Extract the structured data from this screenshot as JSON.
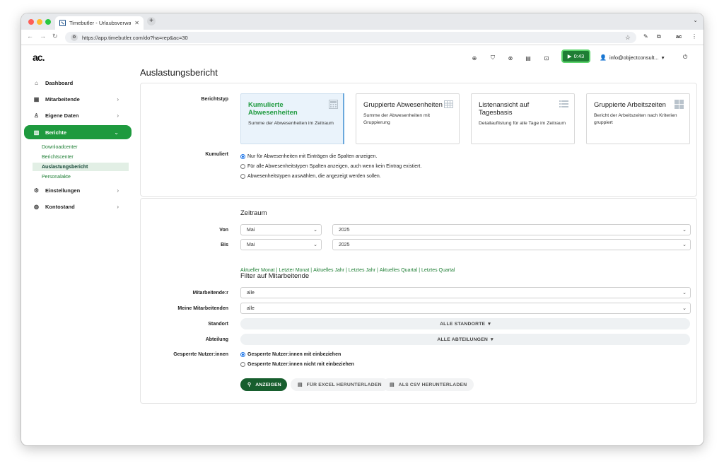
{
  "browser": {
    "tab_title": "Timebutler - Urlaubsverwaltu",
    "url": "https://app.timebutler.com/do?ha=rep&ac=30"
  },
  "header": {
    "logo": "ac.",
    "timer": "0:43",
    "user": "info@objectconsult...",
    "icons": [
      "support-icon",
      "pin-icon",
      "globe-icon",
      "calendar-icon",
      "inbox-icon"
    ]
  },
  "sidebar": {
    "items": [
      {
        "label": "Dashboard",
        "icon": "home-icon"
      },
      {
        "label": "Mitarbeitende",
        "icon": "building-icon"
      },
      {
        "label": "Eigene Daten",
        "icon": "person-icon"
      },
      {
        "label": "Berichte",
        "icon": "chart-icon"
      },
      {
        "label": "Einstellungen",
        "icon": "gear-icon"
      },
      {
        "label": "Kontostand",
        "icon": "wallet-icon"
      }
    ],
    "subitems": [
      "Downloadcenter",
      "Berichtscenter",
      "Auslastungsbericht",
      "Personalakte"
    ]
  },
  "page": {
    "title": "Auslastungsbericht"
  },
  "report": {
    "type_label": "Berichtstyp",
    "types": [
      {
        "title": "Kumulierte Abwesenheiten",
        "desc": "Summe der Abwesenheiten im Zeitraum"
      },
      {
        "title": "Gruppierte Abwesenheiten",
        "desc": "Summe der Abwesenheiten mit Gruppierung"
      },
      {
        "title": "Listenansicht auf Tagesbasis",
        "desc": "Detailauflistung für alle Tage im Zeitraum"
      },
      {
        "title": "Gruppierte Arbeitszeiten",
        "desc": "Bericht der Arbeitszeiten nach Kriterien gruppiert"
      }
    ],
    "kumuliert_label": "Kumuliert",
    "kumuliert_options": [
      "Nur für Abwesenheiten mit Einträgen die Spalten anzeigen.",
      "Für alle Abwesenheitstypen Spalten anzeigen, auch wenn kein Eintrag existiert.",
      "Abwesenheitstypen auswählen, die angezeigt werden sollen."
    ]
  },
  "zeitraum": {
    "title": "Zeitraum",
    "von_label": "Von",
    "bis_label": "Bis",
    "von_month": "Mai",
    "von_year": "2025",
    "bis_month": "Mai",
    "bis_year": "2025",
    "quicklinks": [
      "Aktueller Monat",
      "Letzter Monat",
      "Aktuelles Jahr",
      "Letztes Jahr",
      "Aktuelles Quartal",
      "Letztes Quartal"
    ]
  },
  "filter": {
    "title": "Filter auf Mitarbeitende",
    "mitarbeitende_label": "Mitarbeitende:r",
    "mitarbeitende_value": "alle",
    "meine_label": "Meine Mitarbeitenden",
    "meine_value": "alle",
    "standort_label": "Standort",
    "standort_value": "ALLE STANDORTE",
    "abteilung_label": "Abteilung",
    "abteilung_value": "ALLE ABTEILUNGEN",
    "gesperrte_label": "Gesperrte Nutzer:innen",
    "gesperrte_options": [
      "Gesperrte Nutzer:innen mit einbeziehen",
      "Gesperrte Nutzer:innen nicht mit einbeziehen"
    ]
  },
  "actions": {
    "show": "ANZEIGEN",
    "excel": "FÜR EXCEL HERUNTERLADEN",
    "csv": "ALS CSV HERUNTERLADEN"
  },
  "colors": {
    "brand_green": "#1e9a3e",
    "dark_green": "#175e2e",
    "link_green": "#1e7e34",
    "selected_card": "#eaf3fb"
  }
}
